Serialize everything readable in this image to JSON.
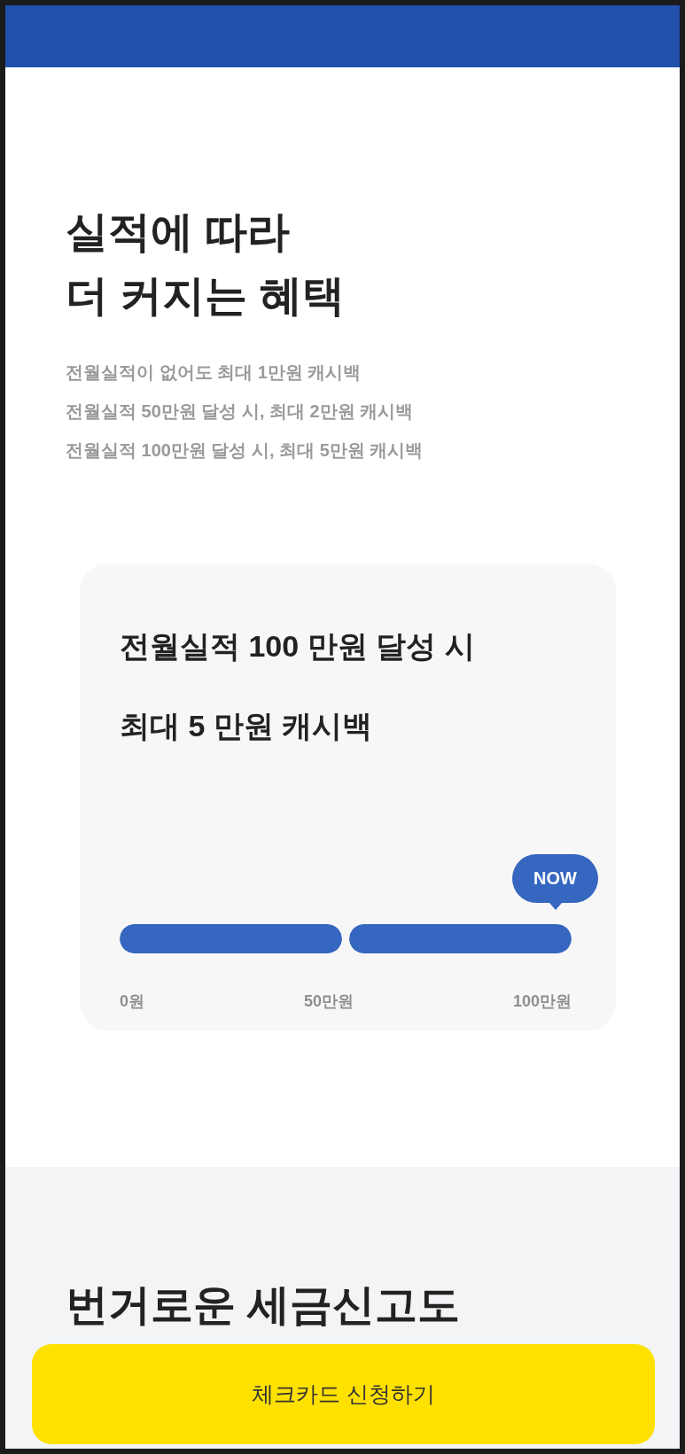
{
  "header": {
    "color": "#2251ab"
  },
  "benefit": {
    "title_lines": [
      "실적에 따라",
      "더 커지는 혜택"
    ],
    "descriptions": [
      "전월실적이 없어도 최대 1만원 캐시백",
      "전월실적 50만원 달성 시, 최대 2만원 캐시백",
      "전월실적 100만원 달성 시, 최대 5만원 캐시백"
    ],
    "card": {
      "title_lines": [
        "전월실적 **100** 만원 달성 시",
        "최대 **5** 만원 캐시백"
      ],
      "now_label": "NOW",
      "segments": [
        {
          "level": 1
        },
        {
          "level": 1
        }
      ],
      "scale_labels": [
        "0원",
        "50만원",
        "100만원"
      ]
    }
  },
  "tax": {
    "title": "번거로운 세금신고도"
  },
  "cta": {
    "label": "체크카드 신청하기"
  }
}
